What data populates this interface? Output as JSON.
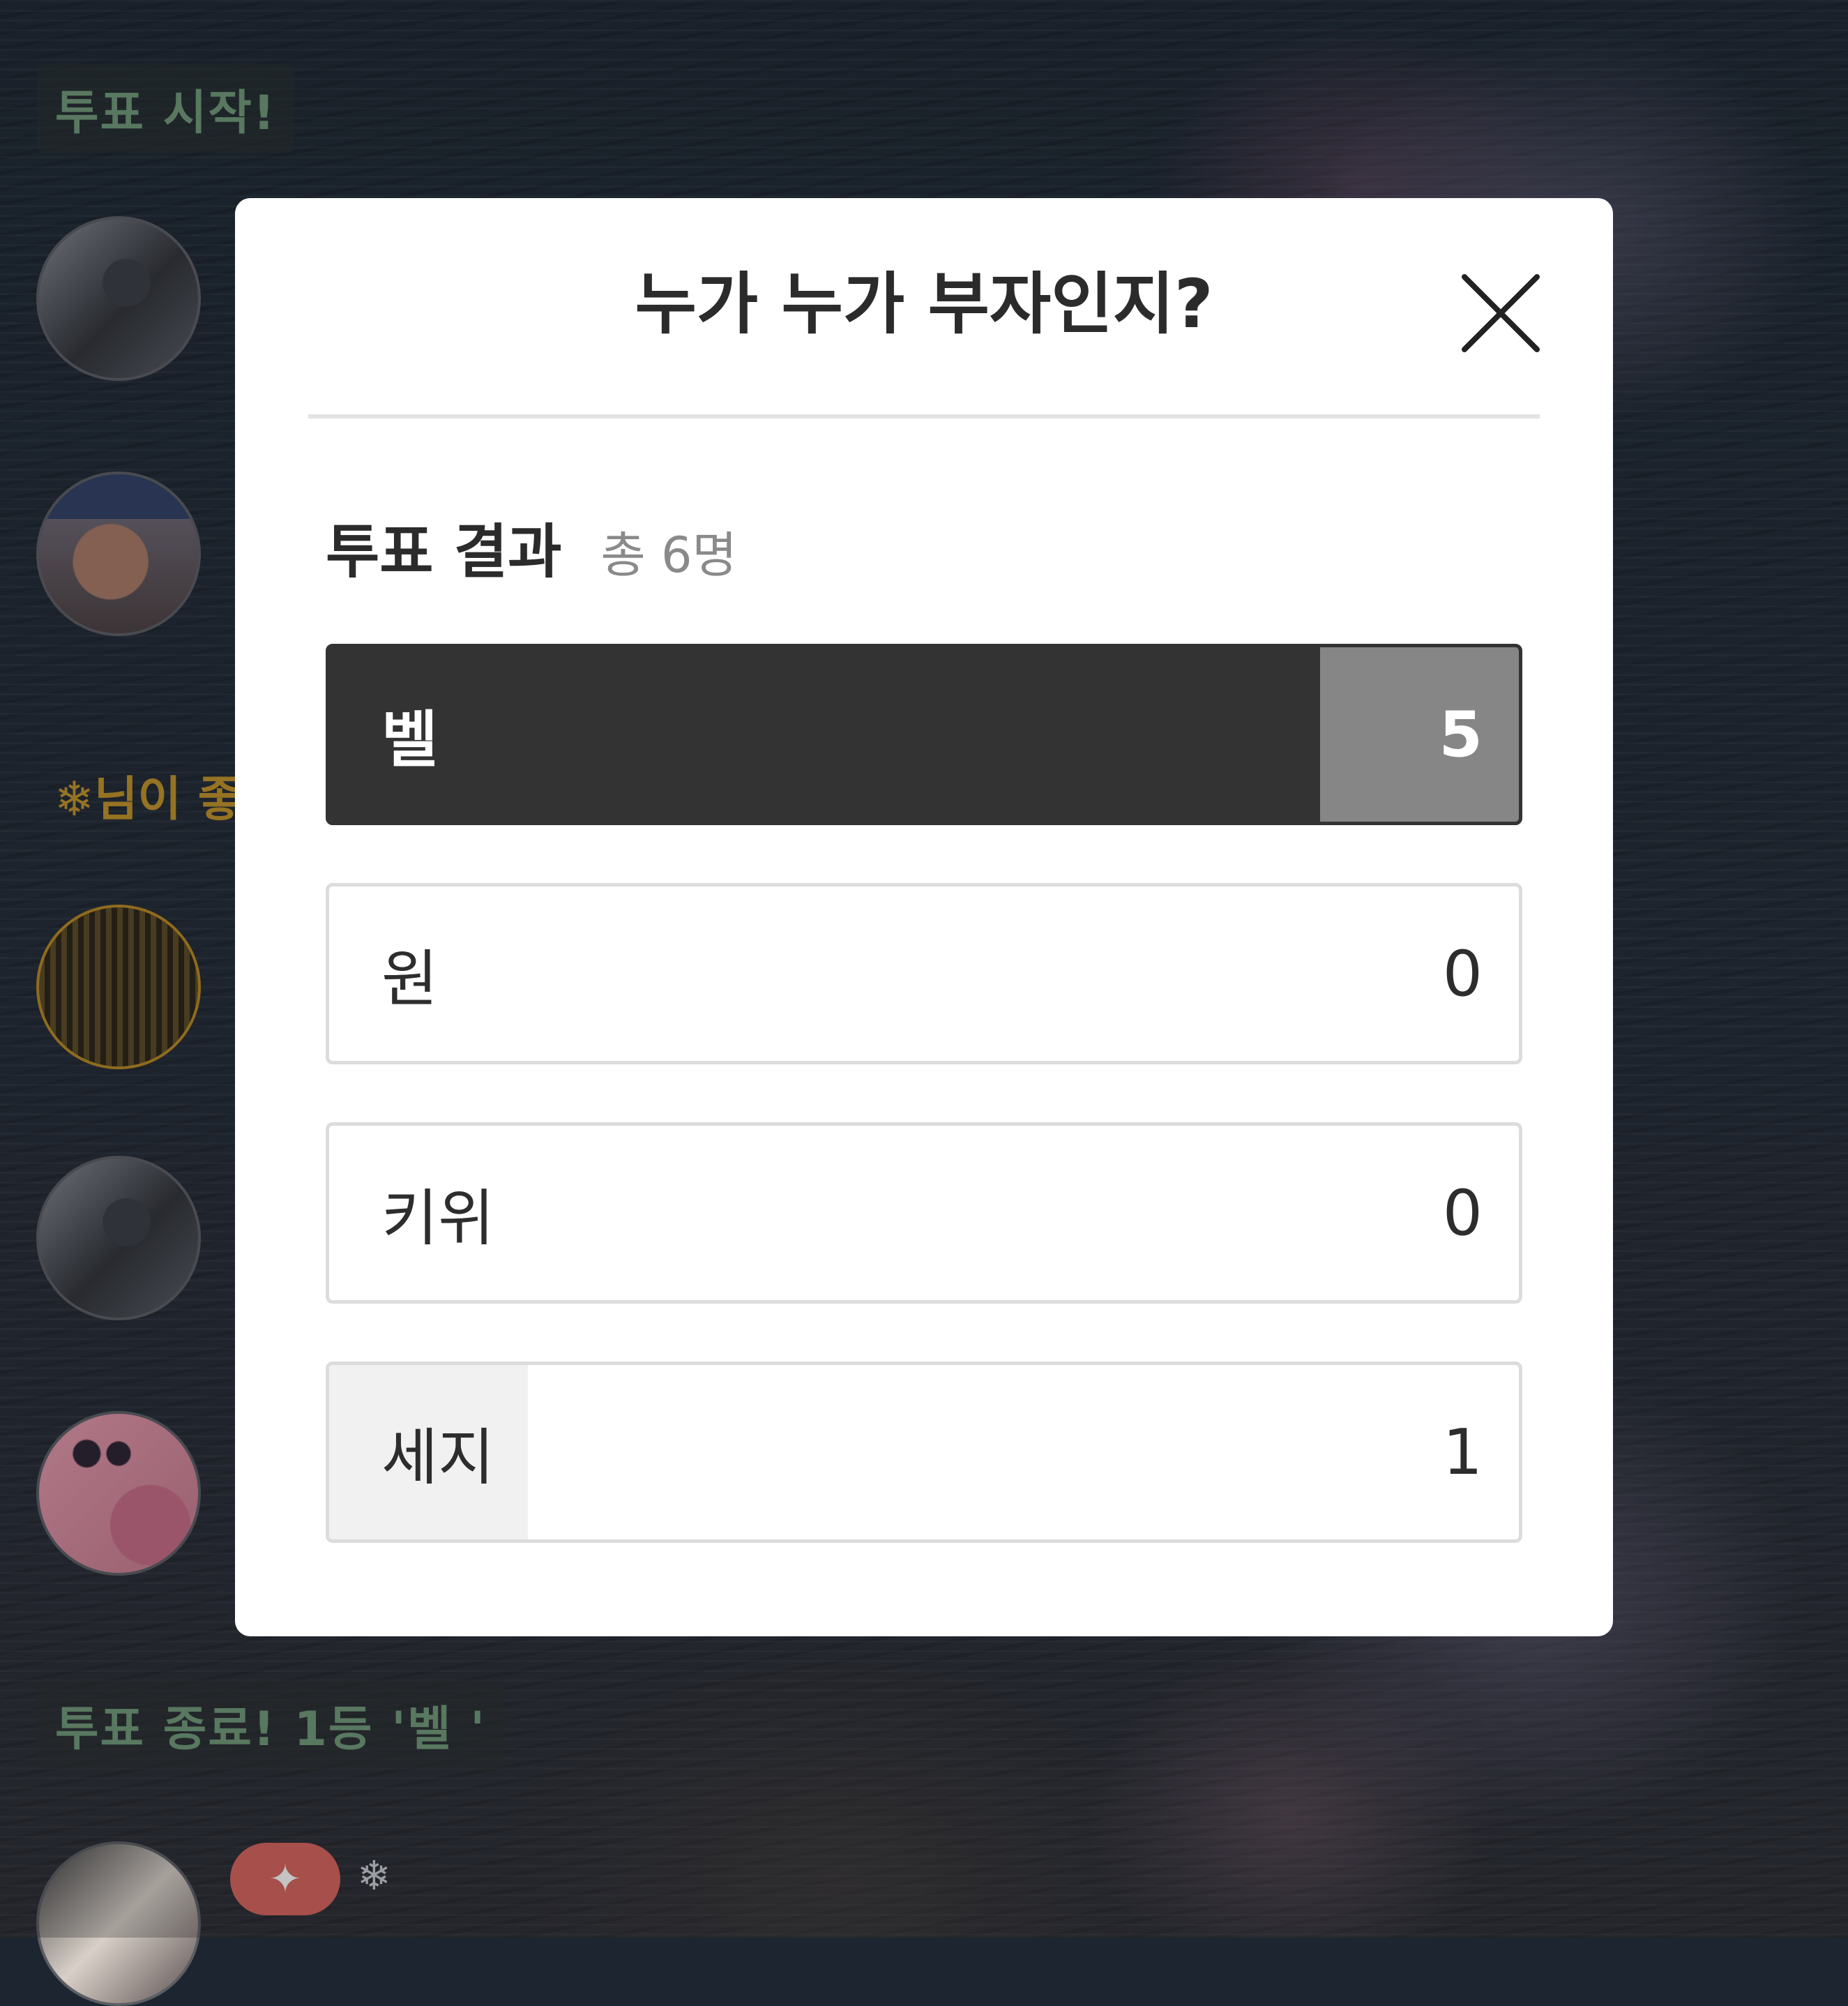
{
  "chat": {
    "vote_start": "투표 시작!",
    "gold_notice": "❄님이 좋",
    "vote_end": "투표 종료! 1등 '벨 '",
    "snow_glyph": "❄"
  },
  "modal": {
    "title": "누가 누가 부자인지?",
    "results_label": "투표 결과",
    "total_label": "총 6명",
    "options": [
      {
        "label": "벨",
        "count": "5",
        "fraction": 0.833
      },
      {
        "label": "원",
        "count": "0",
        "fraction": 0
      },
      {
        "label": "키위",
        "count": "0",
        "fraction": 0
      },
      {
        "label": "세지",
        "count": "1",
        "fraction": 0.167
      }
    ]
  },
  "colors": {
    "leader_fill": "#333333",
    "leader_rest": "#868686",
    "other_fill": "#f1f1f1",
    "banner_text": "#6f9a78",
    "gold_text": "#c09327",
    "heart_badge": "#d9635b"
  },
  "icons": [
    "close-icon",
    "snowflake-icon",
    "sparkle-icon"
  ]
}
